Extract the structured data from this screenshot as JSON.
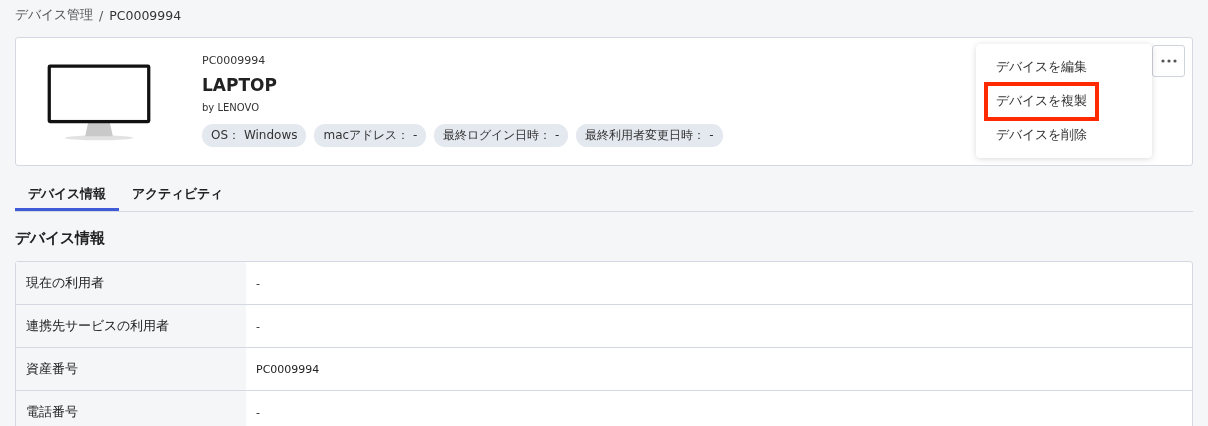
{
  "breadcrumb": {
    "items": [
      "デバイス管理",
      "PC0009994"
    ],
    "separator": "/"
  },
  "device": {
    "asset_id": "PC0009994",
    "name": "LAPTOP",
    "maker": "by LENOVO",
    "tags": [
      "OS： Windows",
      "macアドレス： -",
      "最終ログイン日時： -",
      "最終利用者変更日時： -"
    ]
  },
  "menu": {
    "items": [
      {
        "label": "デバイスを編集",
        "highlighted": false
      },
      {
        "label": "デバイスを複製",
        "highlighted": true
      },
      {
        "label": "デバイスを削除",
        "highlighted": false
      }
    ]
  },
  "tabs": [
    {
      "label": "デバイス情報",
      "selected": true
    },
    {
      "label": "アクティビティ",
      "selected": false
    }
  ],
  "section_title": "デバイス情報",
  "rows": [
    {
      "label": "現在の利用者",
      "value": "-"
    },
    {
      "label": "連携先サービスの利用者",
      "value": "-"
    },
    {
      "label": "資産番号",
      "value": "PC0009994"
    },
    {
      "label": "電話番号",
      "value": "-"
    }
  ]
}
